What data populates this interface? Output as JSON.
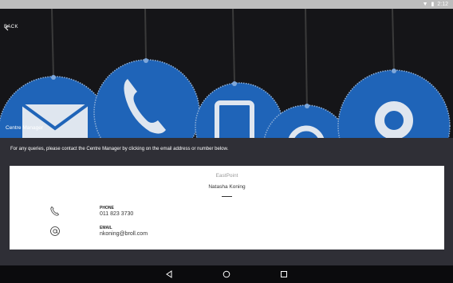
{
  "status_bar": {
    "time": "2:12",
    "icons": [
      "wifi-icon",
      "lock-icon",
      "battery-icon"
    ]
  },
  "header": {
    "back_label": "BACK",
    "title": "Centre Manager"
  },
  "info_text": "For any queries, please contact the Centre Manager by clicking on the email address or number below.",
  "card": {
    "centre_name": "EastPoint",
    "manager_name": "Natasha Koning",
    "phone_label": "PHONE",
    "phone_value": "011 823 3730",
    "email_label": "EMAIL",
    "email_value": "nkoning@broll.com"
  },
  "nav": {
    "icons": [
      "back-triangle-icon",
      "home-circle-icon",
      "recents-square-icon"
    ]
  },
  "colors": {
    "tag_blue": "#1f64b8",
    "background": "#2f2f36",
    "card": "#ffffff"
  }
}
